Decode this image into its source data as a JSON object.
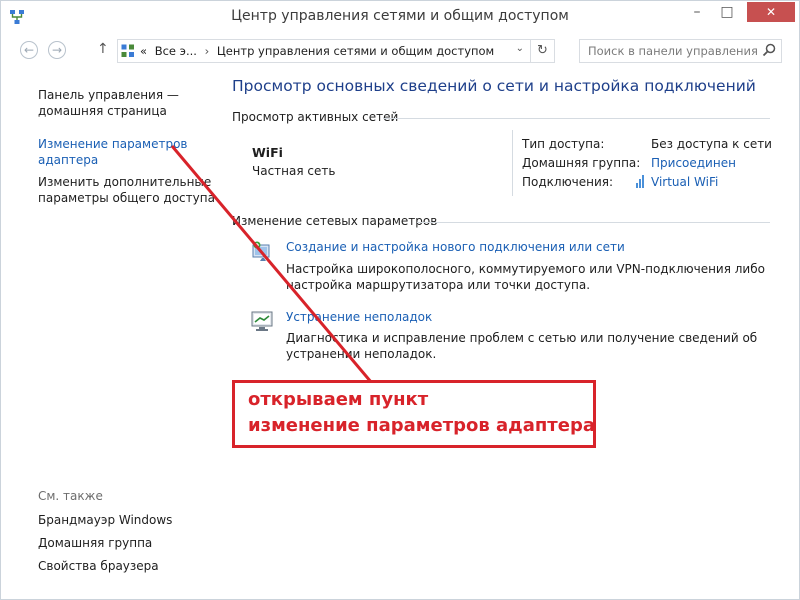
{
  "window": {
    "title": "Центр управления сетями и общим доступом",
    "minimize": "–",
    "maximize": "□",
    "close": "✕"
  },
  "address": {
    "back": "←",
    "forward": "→",
    "up": "↑",
    "crumb_prefix": "«",
    "crumb_1": "Все э...",
    "crumb_sep": "›",
    "crumb_2": "Центр управления сетями и общим доступом",
    "dropdown": "⌄",
    "refresh": "↻",
    "search_placeholder": "Поиск в панели управления"
  },
  "sidebar": {
    "home_line1": "Панель управления —",
    "home_line2": "домашняя страница",
    "adapter_line1": "Изменение параметров",
    "adapter_line2": "адаптера",
    "sharing_line1": "Изменить дополнительные",
    "sharing_line2": "параметры общего доступа",
    "see_also": "См. также",
    "see_also_items": [
      "Брандмауэр Windows",
      "Домашняя группа",
      "Свойства браузера"
    ]
  },
  "main": {
    "title": "Просмотр основных сведений о сети и настройка подключений",
    "active_networks_header": "Просмотр активных сетей",
    "network": {
      "name": "WiFi",
      "type": "Частная сеть",
      "access_label": "Тип доступа:",
      "access_value": "Без доступа к сети",
      "homegroup_label": "Домашняя группа:",
      "homegroup_value": "Присоединен",
      "connections_label": "Подключения:",
      "connections_value": "Virtual WiFi"
    },
    "change_settings_header": "Изменение сетевых параметров",
    "tasks": [
      {
        "link": "Создание и настройка нового подключения или сети",
        "desc": "Настройка широкополосного, коммутируемого или VPN-подключения либо настройка маршрутизатора или точки доступа."
      },
      {
        "link": "Устранение неполадок",
        "desc": "Диагностика и исправление проблем с сетью или получение сведений об устранении неполадок."
      }
    ]
  },
  "annotation": {
    "line1": "открываем пункт",
    "line2": "изменение параметров адаптера",
    "color": "#d8232a"
  },
  "colors": {
    "link": "#1a5fb4",
    "title_blue": "#1e3f8a",
    "close_red": "#c75050"
  }
}
